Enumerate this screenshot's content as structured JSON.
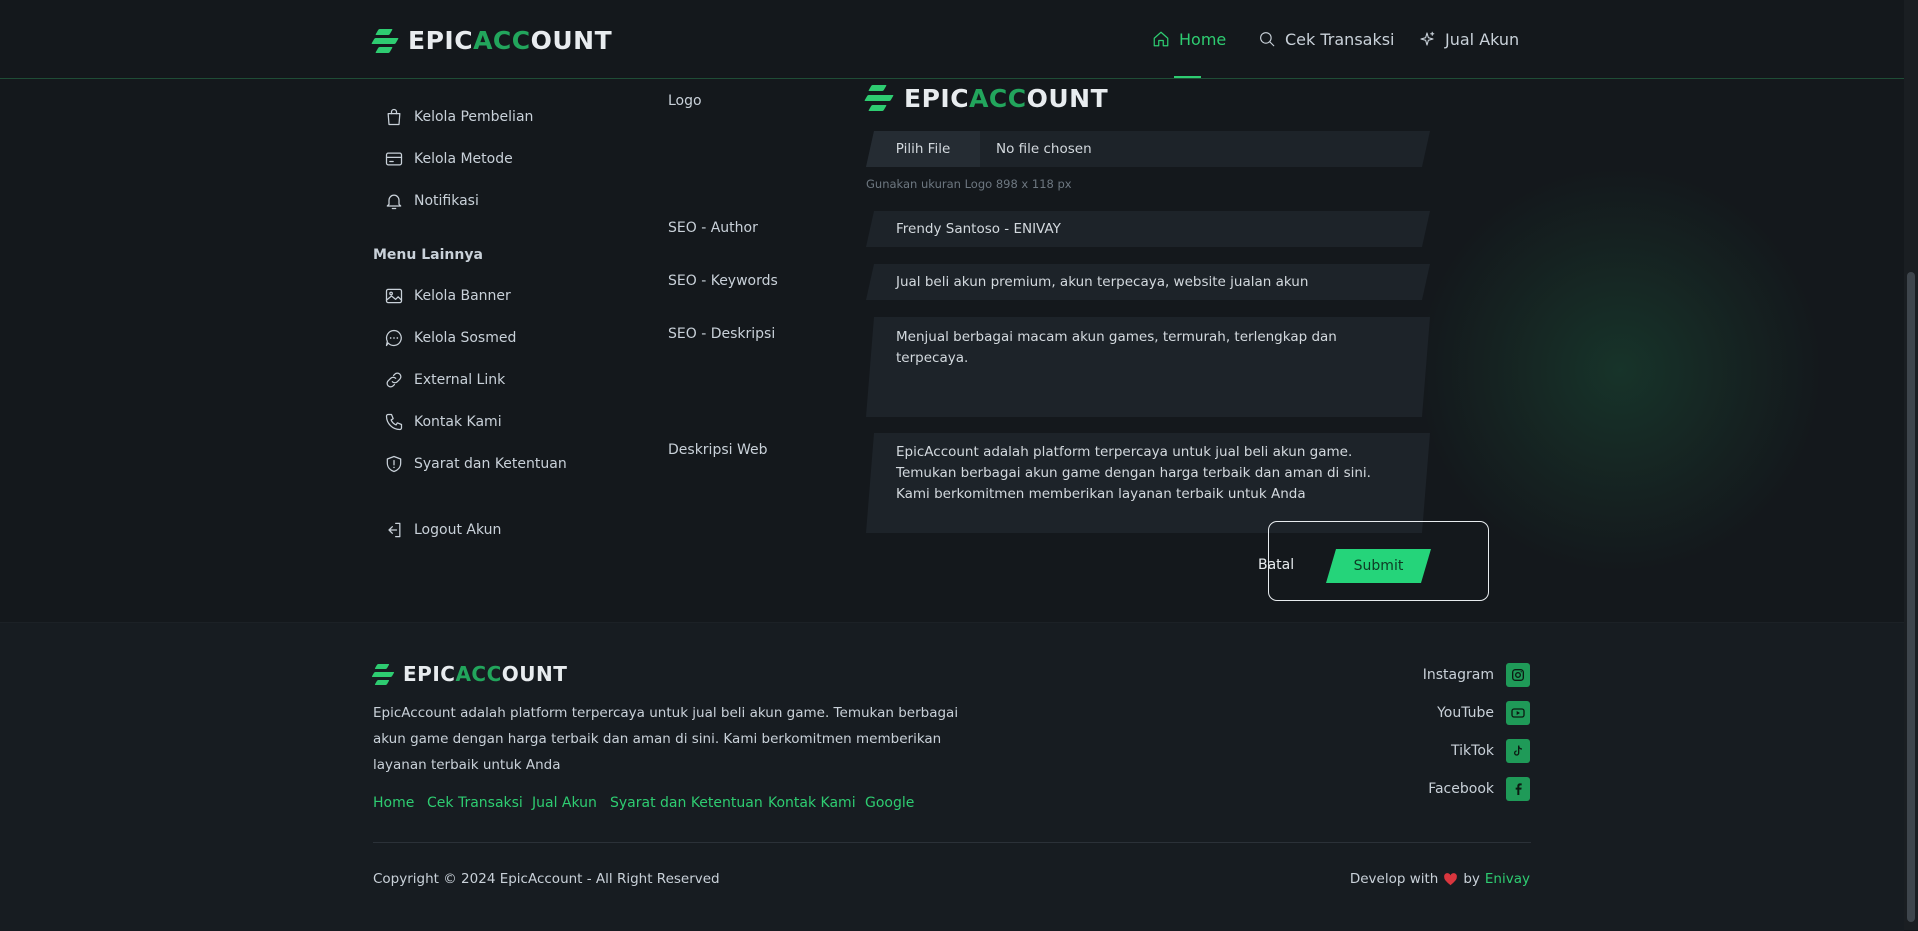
{
  "brand": {
    "part1": "EPIC ",
    "part2": "ACC",
    "part3": "OUNT"
  },
  "nav": {
    "home": "Home",
    "cek_transaksi": "Cek Transaksi",
    "jual_akun": "Jual Akun"
  },
  "sidebar": {
    "items_top": [
      {
        "label": "Kelola Pembelian",
        "icon": "shopping-bag-icon"
      },
      {
        "label": "Kelola Metode",
        "icon": "credit-card-icon"
      },
      {
        "label": "Notifikasi",
        "icon": "bell-icon"
      }
    ],
    "section_title": "Menu Lainnya",
    "items_other": [
      {
        "label": "Kelola Banner",
        "icon": "image-icon"
      },
      {
        "label": "Kelola Sosmed",
        "icon": "chat-icon"
      },
      {
        "label": "External Link",
        "icon": "link-icon"
      },
      {
        "label": "Kontak Kami",
        "icon": "phone-icon"
      },
      {
        "label": "Syarat dan Ketentuan",
        "icon": "shield-icon"
      }
    ],
    "logout": "Logout Akun"
  },
  "form": {
    "logo_label": "Logo",
    "file_button": "Pilih File",
    "file_status": "No file chosen",
    "logo_hint": "Gunakan ukuran Logo 898 x 118 px",
    "seo_author_label": "SEO - Author",
    "seo_author_value": "Frendy Santoso - ENIVAY",
    "seo_keywords_label": "SEO - Keywords",
    "seo_keywords_value": "Jual beli akun premium, akun terpecaya, website jualan akun",
    "seo_desc_label": "SEO - Deskripsi",
    "seo_desc_value": "Menjual berbagai macam akun games, termurah, terlengkap dan terpecaya.",
    "web_desc_label": "Deskripsi Web",
    "web_desc_value": "EpicAccount adalah platform terpercaya untuk jual beli akun game. Temukan berbagai akun game dengan harga terbaik dan aman di sini. Kami berkomitmen memberikan layanan terbaik untuk Anda",
    "cancel": "Batal",
    "submit": "Submit"
  },
  "footer": {
    "description": "EpicAccount adalah platform terpercaya untuk jual beli akun game. Temukan berbagai akun game dengan harga terbaik dan aman di sini. Kami berkomitmen memberikan layanan terbaik untuk Anda",
    "links": [
      "Home",
      "Cek Transaksi",
      "Jual Akun",
      "Syarat dan Ketentuan",
      "Kontak Kami",
      "Google"
    ],
    "social": [
      {
        "label": "Instagram",
        "icon": "instagram-icon"
      },
      {
        "label": "YouTube",
        "icon": "youtube-icon"
      },
      {
        "label": "TikTok",
        "icon": "tiktok-icon"
      },
      {
        "label": "Facebook",
        "icon": "facebook-icon"
      }
    ],
    "copyright": "Copyright © 2024 EpicAccount - All Right Reserved",
    "develop_prefix": "Develop with",
    "develop_by": "by",
    "developer": "Enivay"
  },
  "colors": {
    "accent": "#2ecc71",
    "background": "#14181c",
    "field": "#1d2329"
  }
}
